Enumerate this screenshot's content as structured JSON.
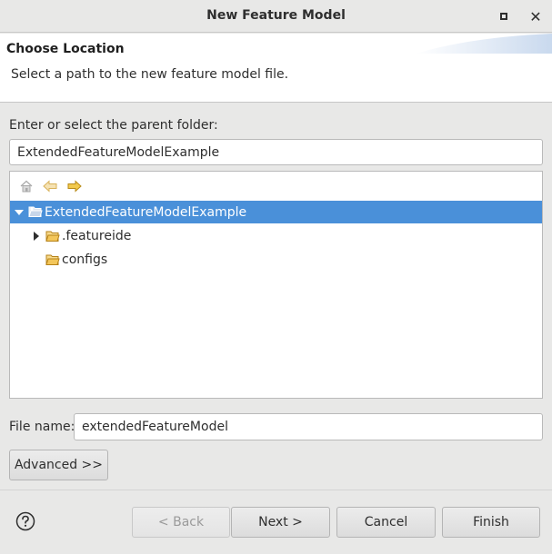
{
  "window": {
    "title": "New Feature Model"
  },
  "banner": {
    "heading": "Choose Location",
    "description": "Select a path to the new feature model file."
  },
  "parent_folder": {
    "label": "Enter or select the parent folder:",
    "value": "ExtendedFeatureModelExample"
  },
  "tree": {
    "toolbar_icons": [
      "home-icon",
      "back-arrow-icon",
      "forward-arrow-icon"
    ],
    "items": [
      {
        "label": "ExtendedFeatureModelExample",
        "expanded": true,
        "selected": true,
        "depth": 0
      },
      {
        "label": ".featureide",
        "expanded": false,
        "selected": false,
        "depth": 1
      },
      {
        "label": "configs",
        "expanded": false,
        "selected": false,
        "depth": 1
      }
    ]
  },
  "file_name": {
    "label": "File name:",
    "value": "extendedFeatureModel"
  },
  "buttons": {
    "advanced": "Advanced >>",
    "back": "< Back",
    "next": "Next >",
    "cancel": "Cancel",
    "finish": "Finish"
  },
  "colors": {
    "selection": "#4a90d9",
    "folder": "#e6a93a",
    "window_bg": "#e8e8e7"
  }
}
